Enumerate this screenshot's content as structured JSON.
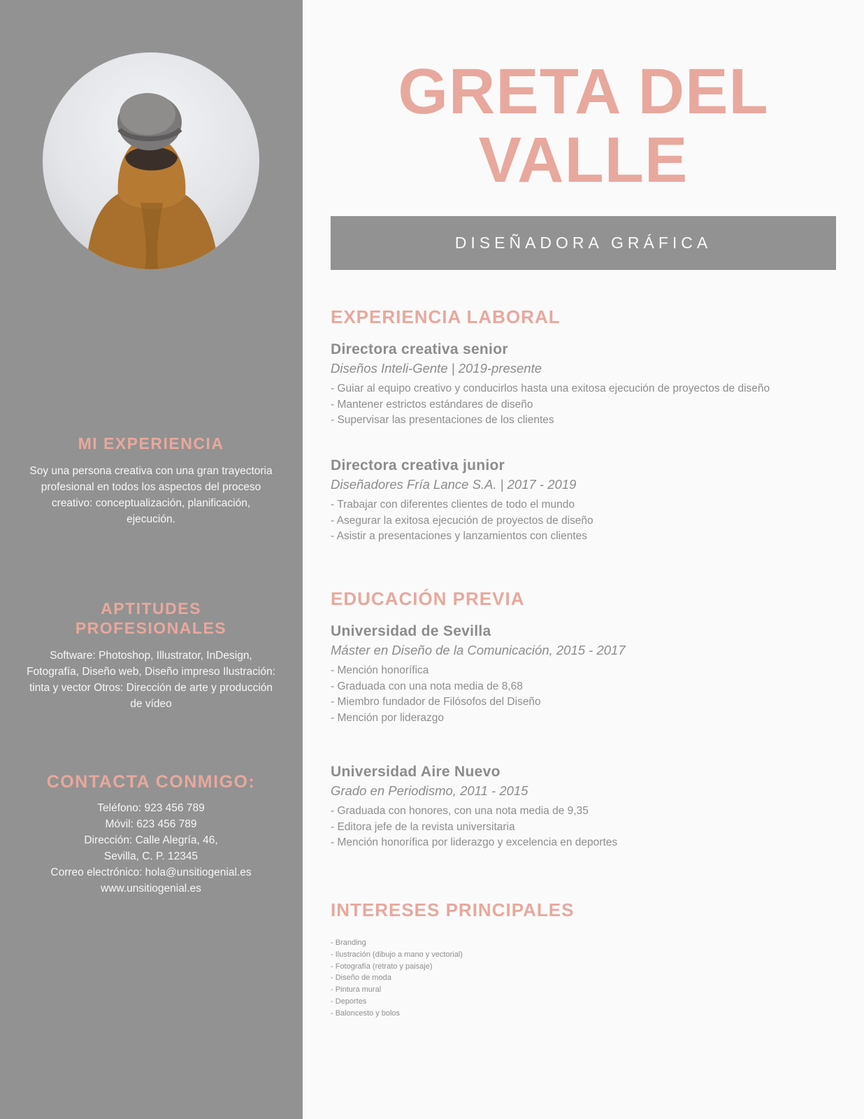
{
  "colors": {
    "accent": "#e8a89d",
    "sidebar_bg": "#929292",
    "page_bg": "#fafafa",
    "body_text": "#8e8e8e"
  },
  "profile": {
    "photo_icon": "person-in-hat-photo",
    "name_line1": "GRETA DEL",
    "name_line2": "VALLE",
    "job_title": "DISEÑADORA GRÁFICA"
  },
  "sidebar": {
    "about": {
      "title": "MI EXPERIENCIA",
      "text": "Soy una persona creativa con una gran trayectoria profesional en todos los aspectos del proceso creativo: conceptualización, planificación, ejecución."
    },
    "skills": {
      "title": "APTITUDES PROFESIONALES",
      "text": "Software: Photoshop, Illustrator, InDesign, Fotografía, Diseño web, Diseño impreso Ilustración: tinta y vector Otros: Dirección de arte y producción de vídeo"
    },
    "contact": {
      "title": "CONTACTA CONMIGO:",
      "lines": [
        "Teléfono: 923 456 789",
        "Móvil: 623 456 789",
        "Dirección: Calle Alegría, 46,",
        "Sevilla, C. P. 12345",
        "Correo electrónico: hola@unsitiogenial.es",
        "www.unsitiogenial.es"
      ]
    }
  },
  "experience": {
    "title": "EXPERIENCIA LABORAL",
    "jobs": [
      {
        "role": "Directora creativa senior",
        "company": "Diseños Inteli-Gente | 2019-presente",
        "bullets": [
          "- Guiar al equipo creativo y conducirlos hasta una exitosa ejecución de proyectos de diseño",
          "- Mantener estrictos estándares de diseño",
          "- Supervisar las presentaciones de los clientes"
        ]
      },
      {
        "role": "Directora creativa junior",
        "company": "Diseñadores Fría Lance S.A. | 2017 - 2019",
        "bullets": [
          "- Trabajar con diferentes clientes de todo el mundo",
          "- Asegurar la exitosa ejecución de proyectos de diseño",
          "- Asistir a presentaciones y lanzamientos con clientes"
        ]
      }
    ]
  },
  "education": {
    "title": "EDUCACIÓN PREVIA",
    "schools": [
      {
        "name": "Universidad de Sevilla",
        "degree": "Máster en Diseño de la Comunicación, 2015 - 2017",
        "bullets": [
          "- Mención honorífica",
          "- Graduada con una nota media de 8,68",
          "- Miembro fundador de Filósofos del Diseño",
          "- Mención por liderazgo"
        ]
      },
      {
        "name": "Universidad Aire Nuevo",
        "degree": "Grado en Periodismo, 2011 - 2015",
        "bullets": [
          "- Graduada con honores, con una nota media de 9,35",
          "- Editora jefe de la revista universitaria",
          "- Mención honorífica por liderazgo y excelencia en deportes"
        ]
      }
    ]
  },
  "interests": {
    "title": "INTERESES PRINCIPALES",
    "items": [
      "- Branding",
      "- Ilustración (dibujo a mano y vectorial)",
      "- Fotografía (retrato y paisaje)",
      "- Diseño de moda",
      "- Pintura mural",
      "- Deportes",
      "- Baloncesto y bolos"
    ]
  }
}
